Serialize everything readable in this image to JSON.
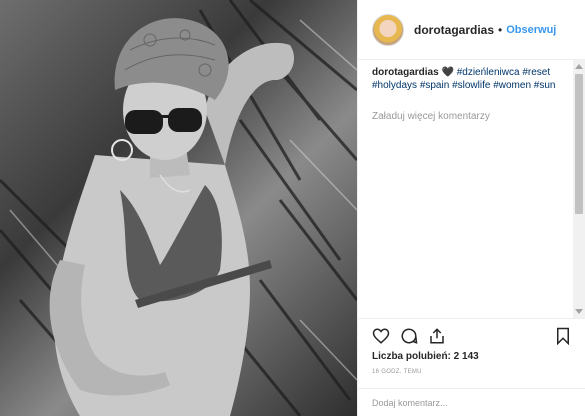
{
  "post": {
    "author": "dorotagardias",
    "separator": "•",
    "follow_label": "Obserwuj"
  },
  "caption": {
    "username": "dorotagardias",
    "heart": "🖤",
    "hashtags": [
      "#dzieńleniwca",
      "#reset",
      "#holydays",
      "#spain",
      "#slowlife",
      "#women",
      "#sun"
    ]
  },
  "load_more_label": "Załaduj więcej komentarzy",
  "likes_label": "Liczba polubień: 2 143",
  "timestamp": "16 GODZ. TEMU",
  "comment": {
    "placeholder": "Dodaj komentarz..."
  },
  "icons": {
    "like": "heart-outline-icon",
    "comment": "speech-bubble-icon",
    "share": "share-icon",
    "save": "bookmark-icon"
  }
}
